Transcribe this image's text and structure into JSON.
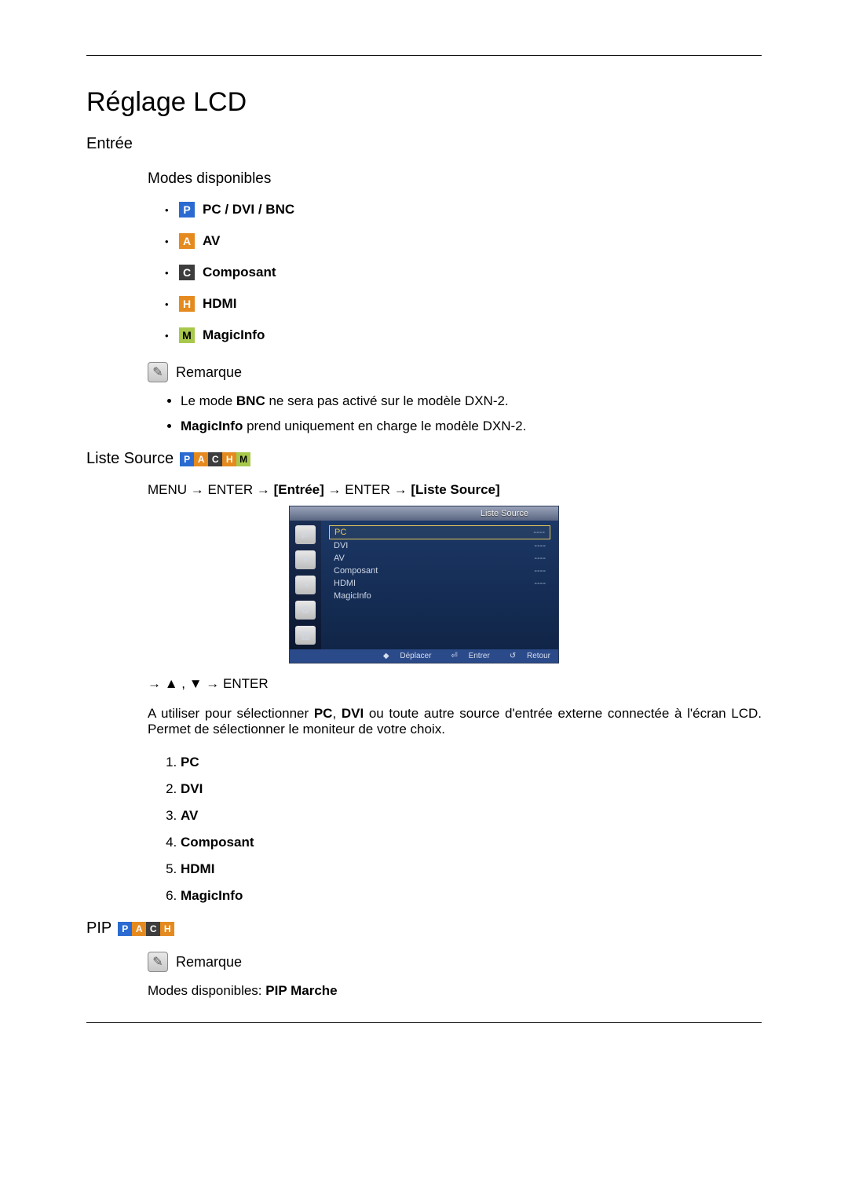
{
  "title": "Réglage LCD",
  "section_entree": "Entrée",
  "section_modes": "Modes disponibles",
  "modes": {
    "p": "PC / DVI / BNC",
    "a": "AV",
    "c": "Composant",
    "h": "HDMI",
    "m": "MagicInfo"
  },
  "remarque_label": "Remarque",
  "notes": {
    "n1_pre": "Le mode ",
    "n1_b": "BNC",
    "n1_post": " ne sera pas activé sur le modèle DXN-2.",
    "n2_b": "MagicInfo",
    "n2_post": " prend uniquement en charge le modèle DXN-2."
  },
  "section_liste_source": "Liste Source",
  "menu_path": {
    "p1": "MENU → ENTER → ",
    "b1": "[Entrée]",
    "p2": " → ENTER → ",
    "b2": "[Liste Source]"
  },
  "osd": {
    "header": "Liste Source",
    "rows": [
      {
        "label": "PC",
        "val": "----",
        "sel": true
      },
      {
        "label": "DVI",
        "val": "----",
        "sel": false
      },
      {
        "label": "AV",
        "val": "----",
        "sel": false
      },
      {
        "label": "Composant",
        "val": "----",
        "sel": false
      },
      {
        "label": "HDMI",
        "val": "----",
        "sel": false
      },
      {
        "label": "MagicInfo",
        "val": "",
        "sel": false
      }
    ],
    "footer": {
      "move": "Déplacer",
      "enter": "Entrer",
      "return": "Retour"
    }
  },
  "nav_line": "→ ▲ , ▼ → ENTER",
  "desc_p1": "A utiliser pour sélectionner ",
  "desc_b1": "PC",
  "desc_p2": ", ",
  "desc_b2": "DVI",
  "desc_p3": " ou toute autre source d'entrée externe connectée à l'écran LCD. Permet de sélectionner le moniteur de votre choix.",
  "numlist": [
    "PC",
    "DVI",
    "AV",
    "Composant",
    "HDMI",
    "MagicInfo"
  ],
  "section_pip": "PIP",
  "pip_modes_pre": "Modes disponibles: ",
  "pip_modes_b": "PIP Marche",
  "badge_letters": {
    "p": "P",
    "a": "A",
    "c": "C",
    "h": "H",
    "m": "M"
  }
}
